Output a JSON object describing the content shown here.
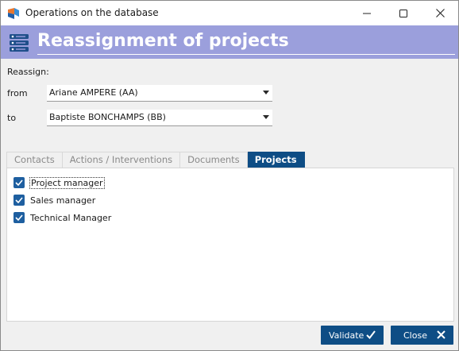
{
  "window": {
    "title": "Operations on the database",
    "controls": [
      "minimize-icon",
      "maximize-icon",
      "close-icon"
    ]
  },
  "banner": {
    "icon": "database-server-icon",
    "title": "Reassignment of projects",
    "color": "#9b9fdc"
  },
  "form": {
    "reassign_label": "Reassign:",
    "from_label": "from",
    "from_value": "Ariane AMPERE (AA)",
    "to_label": "to",
    "to_value": "Baptiste BONCHAMPS (BB)"
  },
  "tabs": [
    {
      "label": "Contacts",
      "active": false
    },
    {
      "label": "Actions / Interventions",
      "active": false
    },
    {
      "label": "Documents",
      "active": false
    },
    {
      "label": "Projects",
      "active": true
    }
  ],
  "projects": {
    "options": [
      {
        "label": "Project manager",
        "checked": true,
        "focused": true
      },
      {
        "label": "Sales manager",
        "checked": true,
        "focused": false
      },
      {
        "label": "Technical Manager",
        "checked": true,
        "focused": false
      }
    ]
  },
  "footer": {
    "validate_label": "Validate",
    "validate_icon": "checkmark-icon",
    "close_label": "Close",
    "close_icon": "close-x-icon"
  },
  "colors": {
    "accent": "#0e4d85",
    "checkbox": "#1e5fa0"
  }
}
